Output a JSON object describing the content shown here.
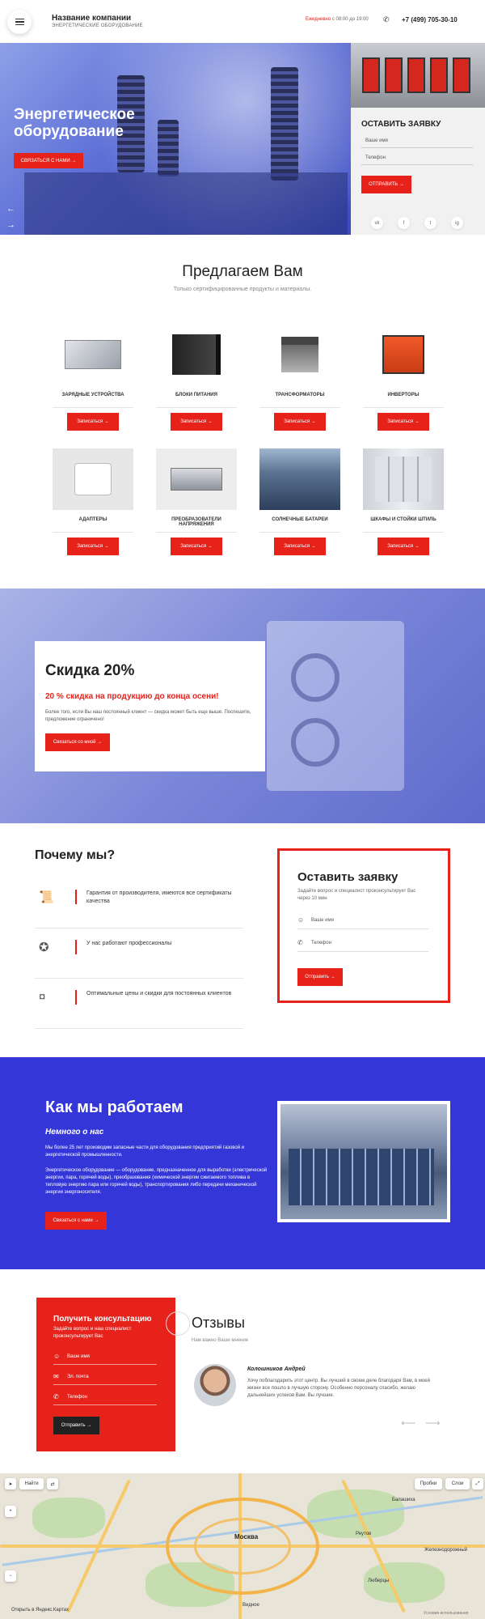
{
  "header": {
    "company_name": "Название компании",
    "company_sub": "ЭНЕРГЕТИЧЕСКИЕ ОБОРУДОВАНИЕ",
    "hours_label": "Ежедневно",
    "hours_value": "с 08:00 до 19:00",
    "phone": "+7 (499) 705-30-10"
  },
  "hero": {
    "title": "Энергетическое оборудование",
    "cta": "СВЯЗАТЬСЯ С НАМИ"
  },
  "side_form": {
    "title": "ОСТАВИТЬ ЗАЯВКУ",
    "name_ph": "Ваше имя",
    "phone_ph": "Телефон",
    "submit": "ОТПРАВИТЬ",
    "socials": [
      "vk",
      "f",
      "t",
      "ig"
    ]
  },
  "offers": {
    "title": "Предлагаем Вам",
    "subtitle": "Только сертифицированные продукты и материалы.",
    "button": "Записаться",
    "products": [
      {
        "name": "ЗАРЯДНЫЕ УСТРОЙСТВА"
      },
      {
        "name": "БЛОКИ ПИТАНИЯ"
      },
      {
        "name": "ТРАНСФОРМАТОРЫ"
      },
      {
        "name": "ИНВЕРТОРЫ"
      },
      {
        "name": "АДАПТЕРЫ"
      },
      {
        "name": "ПРЕОБРАЗОВАТЕЛИ НАПРЯЖЕНИЯ"
      },
      {
        "name": "СОЛНЕЧНЫЕ БАТАРЕИ"
      },
      {
        "name": "ШКАФЫ И СТОЙКИ ШТИЛЬ"
      }
    ]
  },
  "discount": {
    "title": "Скидка 20%",
    "red": "20 % скидка на продукцию до конца осени!",
    "text": "Более того, если Вы наш постоянный клиент — скидка может быть еще выше. Поспешите, предложение ограничено!",
    "cta": "Связаться со мной"
  },
  "why": {
    "title": "Почему мы?",
    "items": [
      {
        "text": "Гарантия от производителя, имеются все сертификаты качества"
      },
      {
        "text": "У нас работают профессионалы"
      },
      {
        "text": "Оптимальные цены и скидки для постоянных клиентов"
      }
    ]
  },
  "order": {
    "title": "Оставить заявку",
    "subtitle": "Задайте вопрос и специалист проконсультирует Вас через 10 мин",
    "name_ph": "Ваше имя",
    "phone_ph": "Телефон",
    "submit": "Отправить"
  },
  "how": {
    "title": "Как мы работаем",
    "subtitle": "Немного о нас",
    "p1": "Мы более 25 лет производим запасные части для оборудования предприятий газовой и энергетической промышленности.",
    "p2": "Энергетическое оборудование — оборудование, предназначенное для выработки (электрической энергии, пара, горячей воды), преобразования (химической энергии сжигаемого топлива в тепловую энергию пара или горячей воды), транспортирования либо передачи механической энергии энергоносителя.",
    "cta": "Связаться с нами"
  },
  "consult": {
    "title": "Получить консультацию",
    "subtitle": "Задайте вопрос и наш специалист проконсультирует Вас",
    "name_ph": "Ваше имя",
    "email_ph": "Эл. почта",
    "phone_ph": "Телефон",
    "submit": "Отправить"
  },
  "reviews": {
    "title": "Отзывы",
    "subtitle": "Нам важно Ваше мнение",
    "name": "Колошников Андрей",
    "text": "Хочу поблагодарить этот центр. Вы лучший в своем деле благодаря Вам, в моей жизни все пошло в лучшую сторону. Особенно персоналу спасибо, желаю дальнейших успехов Вам. Вы лучшие."
  },
  "map": {
    "search": "Найти",
    "traffic": "Пробки",
    "layers": "Слои",
    "city": "Москва",
    "labels": [
      "Балашиха",
      "Реутов",
      "Железнодорожный",
      "Видное",
      "Люберцы"
    ],
    "footer": "Открыть в Яндекс.Картах",
    "terms": "Условия использования"
  }
}
